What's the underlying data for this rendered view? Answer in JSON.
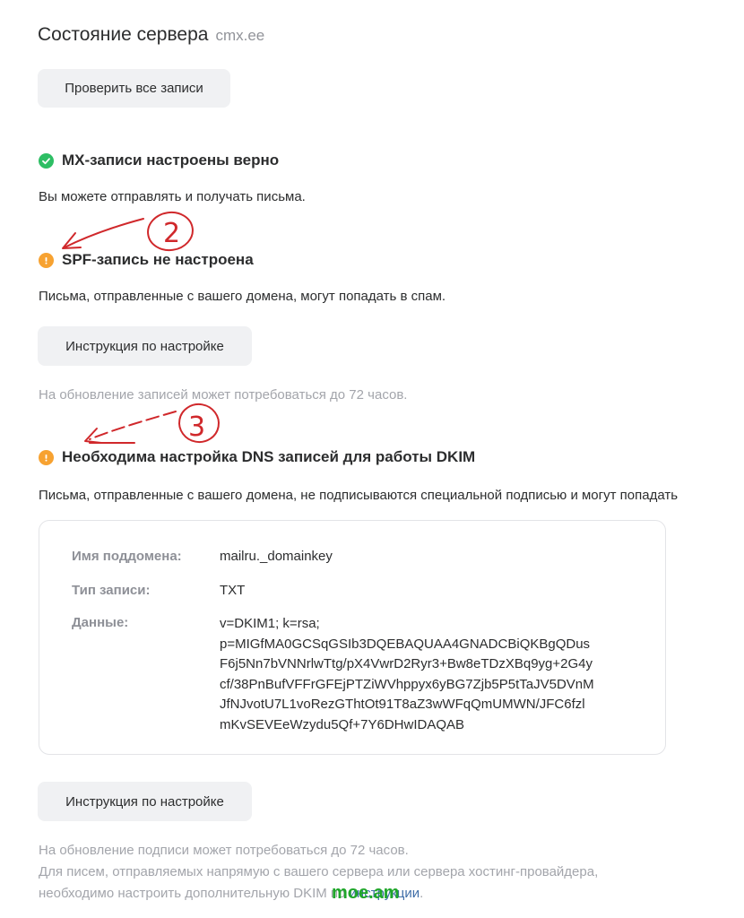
{
  "header": {
    "title": "Состояние сервера",
    "domain": "cmx.ee"
  },
  "toolbar": {
    "check_all_label": "Проверить все записи"
  },
  "mx": {
    "status": "ok",
    "heading": "MX-записи настроены верно",
    "description": "Вы можете отправлять и получать письма."
  },
  "spf": {
    "status": "warning",
    "heading": "SPF-запись не настроена",
    "description": "Письма, отправленные с вашего домена, могут попадать в спам.",
    "instruction_label": "Инструкция по настройке",
    "note": "На обновление записей может потребоваться до 72 часов."
  },
  "dkim": {
    "status": "warning",
    "heading": "Необходима настройка DNS записей для работы DKIM",
    "description": "Письма, отправленные с вашего домена, не подписываются специальной подписью и могут попадать",
    "record": {
      "subdomain_label": "Имя поддомена:",
      "subdomain_value": "mailru._domainkey",
      "type_label": "Тип записи:",
      "type_value": "TXT",
      "data_label": "Данные:",
      "data_value": "v=DKIM1; k=rsa;\np=MIGfMA0GCSqGSIb3DQEBAQUAA4GNADCBiQKBgQDus\nF6j5Nn7bVNNrlwTtg/pX4VwrD2Ryr3+Bw8eTDzXBq9yg+2G4y\ncf/38PnBufVFFrGFEjPTZiWVhppyx6yBG7Zjb5P5tTaJV5DVnM\nJfNJvotU7L1voRezGThtOt91T8aZ3wWFqQmUMWN/JFC6fzl\nmKvSEVEeWzydu5Qf+7Y6DHwIDAQAB"
    },
    "instruction_label": "Инструкция по настройке",
    "note_line1": "На обновление подписи может потребоваться до 72 часов.",
    "note_line2": "Для писем, отправляемых напрямую с вашего сервера или сервера хостинг-провайдера,",
    "note_line3_prefix": "необходимо настроить дополнительную DKIM по ",
    "note_line3_link": "инструкции",
    "note_line3_suffix": "."
  },
  "annotations": {
    "marker_2": "2",
    "marker_3": "3",
    "color": "#d0282b"
  },
  "watermark": {
    "text": "moe.am",
    "color": "#1fa62a"
  },
  "colors": {
    "ok": "#2dbe64",
    "warning": "#f7a231",
    "button_bg": "#f0f1f3",
    "muted_text": "#a3a5ab",
    "link": "#3f6ea8"
  }
}
